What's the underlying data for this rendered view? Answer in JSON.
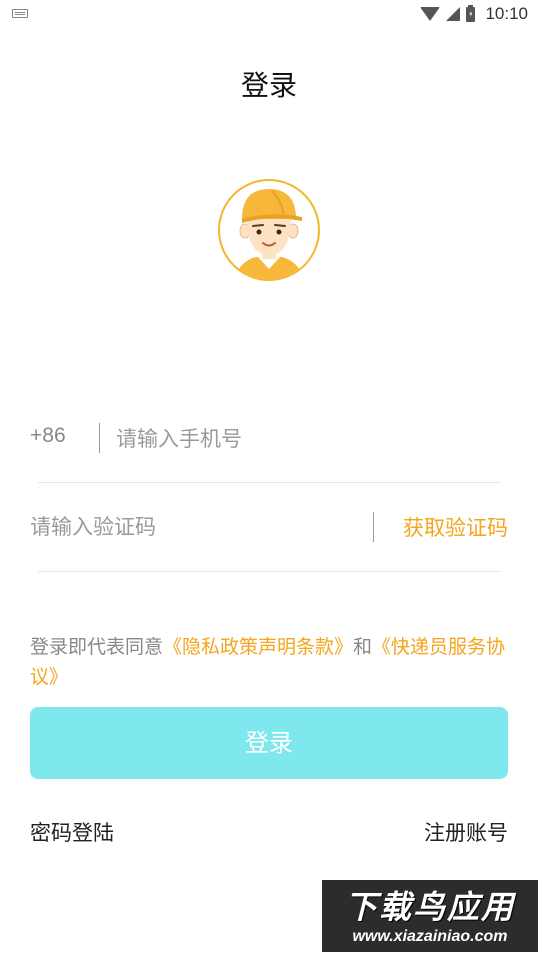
{
  "status_bar": {
    "time": "10:10",
    "icons": [
      "keyboard-icon",
      "wifi-icon",
      "signal-icon",
      "battery-icon"
    ]
  },
  "header": {
    "title": "登录"
  },
  "avatar": {
    "icon": "courier-avatar-icon"
  },
  "phone": {
    "country_code": "+86",
    "placeholder": "请输入手机号",
    "value": ""
  },
  "verification": {
    "placeholder": "请输入验证码",
    "value": "",
    "get_code_label": "获取验证码"
  },
  "agreement": {
    "prefix": "登录即代表同意",
    "privacy_link": "《隐私政策声明条款》",
    "connector": "和",
    "courier_link": "《快递员服务协议》"
  },
  "login_button": {
    "label": "登录"
  },
  "footer": {
    "password_login": "密码登陆",
    "register": "注册账号"
  },
  "watermark": {
    "title": "下载鸟应用",
    "url": "www.xiazainiao.com"
  },
  "colors": {
    "accent_orange": "#f4a51c",
    "login_button": "#7fe8ef",
    "avatar_ring": "#f4b62c"
  }
}
